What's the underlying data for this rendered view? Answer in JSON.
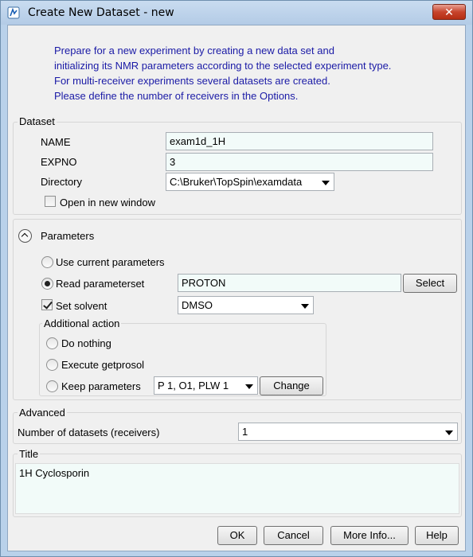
{
  "window": {
    "title": "Create New Dataset - new",
    "close_glyph": "✕"
  },
  "intro": {
    "lines": [
      "Prepare for a new experiment by creating a new data set and",
      "initializing its NMR parameters according to the selected experiment type.",
      "For multi-receiver experiments several datasets are created.",
      "Please define the number of receivers in the Options."
    ],
    "color": "#1a1aa6"
  },
  "dataset": {
    "legend": "Dataset",
    "name_label": "NAME",
    "name_value": "exam1d_1H",
    "expno_label": "EXPNO",
    "expno_value": "3",
    "directory_label": "Directory",
    "directory_value": "C:\\Bruker\\TopSpin\\examdata",
    "open_new_window_label": "Open in new window",
    "open_new_window_checked": false
  },
  "parameters": {
    "header": "Parameters",
    "use_current_label": "Use current parameters",
    "read_paramset_label": "Read parameterset",
    "paramset_value": "PROTON",
    "select_button": "Select",
    "set_solvent_label": "Set solvent",
    "set_solvent_checked": true,
    "solvent_value": "DMSO",
    "additional_action": {
      "legend": "Additional action",
      "do_nothing_label": "Do nothing",
      "execute_getprosol_label": "Execute getprosol",
      "keep_parameters_label": "Keep parameters",
      "keep_params_value": "P 1, O1, PLW 1",
      "change_button": "Change"
    }
  },
  "advanced": {
    "legend": "Advanced",
    "num_datasets_label": "Number of datasets (receivers)",
    "num_datasets_value": "1"
  },
  "title_section": {
    "legend": "Title",
    "value": "1H Cyclosporin"
  },
  "buttons": {
    "ok": "OK",
    "cancel": "Cancel",
    "more_info": "More Info...",
    "help": "Help"
  }
}
